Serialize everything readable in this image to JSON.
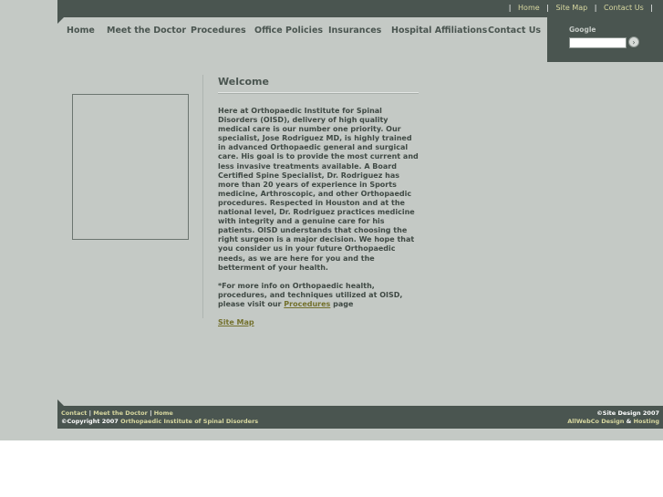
{
  "top_links": {
    "home": "Home",
    "site_map": "Site Map",
    "contact_us": "Contact Us",
    "separator": "|"
  },
  "nav": {
    "items": [
      {
        "label": "Home"
      },
      {
        "label": "Meet the Doctor"
      },
      {
        "label": "Procedures"
      },
      {
        "label": "Office Policies"
      },
      {
        "label": "Insurances"
      },
      {
        "label": "Hospital Affiliations"
      },
      {
        "label": "Contact Us"
      }
    ]
  },
  "search": {
    "label": "Google",
    "value": "",
    "go_glyph": "›"
  },
  "content": {
    "title": "Welcome",
    "body": "Here at Orthopaedic Institute for Spinal Disorders (OISD), delivery of high quality medical care is our number one priority. Our specialist, Jose Rodriguez MD, is highly trained in advanced Orthopaedic general and surgical care. His goal is to provide the most current and less invasive treatments available. A Board Certified Spine Specialist, Dr. Rodriguez has more than 20 years of experience in Sports medicine, Arthroscopic, and other Orthopaedic procedures. Respected in Houston and at the national level, Dr. Rodriguez practices medicine with integrity and a genuine care for his patients. OISD understands that choosing the right surgeon is a major decision. We hope that you consider us in your future Orthopaedic needs, as we are here for you and the betterment of your health.",
    "more_info_prefix": "*For more info on Orthopaedic health, procedures, and techniques utilized at OISD, please visit our",
    "more_info_link": "Procedures",
    "more_info_suffix": "page",
    "site_map_link": "Site Map"
  },
  "footer": {
    "link_contact": "Contact",
    "link_meet_doctor": "Meet the Doctor",
    "link_home": "Home",
    "separator": "|",
    "copyright_prefix": "©Copyright 2007",
    "copyright_link": "Orthopaedic Institute of Spinal Disorders",
    "site_design": "©Site Design 2007",
    "design_link": "AllWebCo Design",
    "amp": "&",
    "hosting_link": "Hosting"
  },
  "colors": {
    "background": "#c4c9c5",
    "bar": "#4a5550",
    "link_accent": "#73702c"
  }
}
